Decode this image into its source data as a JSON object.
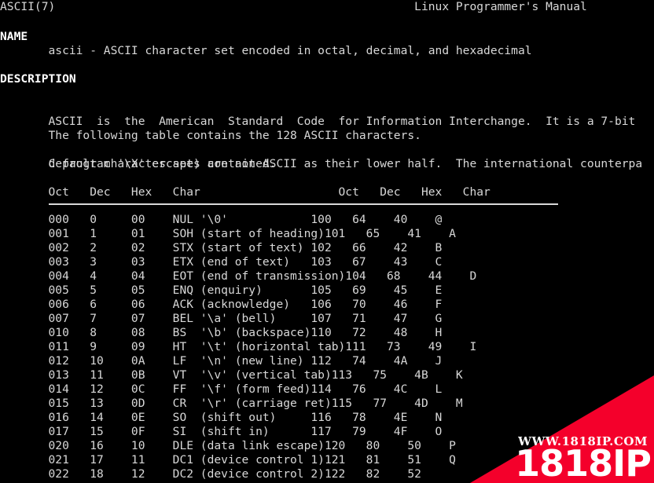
{
  "terminal": {
    "background_color": "#000000",
    "foreground_color": "#d8d8d8",
    "bold_color": "#ffffff"
  },
  "manpage": {
    "header_left": "ASCII(7)",
    "header_center": "Linux Programmer's Manual",
    "header_line": "ASCII(7)                                                    Linux Programmer's Manual",
    "sections": {
      "name_heading": "NAME",
      "name_body": "       ascii - ASCII character set encoded in octal, decimal, and hexadecimal",
      "description_heading": "DESCRIPTION",
      "description_line1": "       ASCII  is  the  American  Standard  Code  for Information Interchange.  It is a 7-bit",
      "description_line2": "       default character set) contain ASCII as their lower half.  The international counterpa",
      "table_intro": "       The following table contains the 128 ASCII characters.",
      "escape_note": "       C program '\\X' escapes are noted."
    }
  },
  "table": {
    "header_line": "       Oct   Dec   Hex   Char                    Oct   Dec   Hex   Char",
    "columns": [
      "Oct",
      "Dec",
      "Hex",
      "Char"
    ],
    "rule_visible": true,
    "rows": [
      {
        "left": {
          "oct": "000",
          "dec": "0",
          "hex": "00",
          "char": "NUL '\\0'"
        },
        "right": {
          "oct": "100",
          "dec": "64",
          "hex": "40",
          "char": "@"
        }
      },
      {
        "left": {
          "oct": "001",
          "dec": "1",
          "hex": "01",
          "char": "SOH (start of heading)"
        },
        "right": {
          "oct": "101",
          "dec": "65",
          "hex": "41",
          "char": "A"
        }
      },
      {
        "left": {
          "oct": "002",
          "dec": "2",
          "hex": "02",
          "char": "STX (start of text)"
        },
        "right": {
          "oct": "102",
          "dec": "66",
          "hex": "42",
          "char": "B"
        }
      },
      {
        "left": {
          "oct": "003",
          "dec": "3",
          "hex": "03",
          "char": "ETX (end of text)"
        },
        "right": {
          "oct": "103",
          "dec": "67",
          "hex": "43",
          "char": "C"
        }
      },
      {
        "left": {
          "oct": "004",
          "dec": "4",
          "hex": "04",
          "char": "EOT (end of transmission)"
        },
        "right": {
          "oct": "104",
          "dec": "68",
          "hex": "44",
          "char": "D"
        }
      },
      {
        "left": {
          "oct": "005",
          "dec": "5",
          "hex": "05",
          "char": "ENQ (enquiry)"
        },
        "right": {
          "oct": "105",
          "dec": "69",
          "hex": "45",
          "char": "E"
        }
      },
      {
        "left": {
          "oct": "006",
          "dec": "6",
          "hex": "06",
          "char": "ACK (acknowledge)"
        },
        "right": {
          "oct": "106",
          "dec": "70",
          "hex": "46",
          "char": "F"
        }
      },
      {
        "left": {
          "oct": "007",
          "dec": "7",
          "hex": "07",
          "char": "BEL '\\a' (bell)"
        },
        "right": {
          "oct": "107",
          "dec": "71",
          "hex": "47",
          "char": "G"
        }
      },
      {
        "left": {
          "oct": "010",
          "dec": "8",
          "hex": "08",
          "char": "BS  '\\b' (backspace)"
        },
        "right": {
          "oct": "110",
          "dec": "72",
          "hex": "48",
          "char": "H"
        }
      },
      {
        "left": {
          "oct": "011",
          "dec": "9",
          "hex": "09",
          "char": "HT  '\\t' (horizontal tab)"
        },
        "right": {
          "oct": "111",
          "dec": "73",
          "hex": "49",
          "char": "I"
        }
      },
      {
        "left": {
          "oct": "012",
          "dec": "10",
          "hex": "0A",
          "char": "LF  '\\n' (new line)"
        },
        "right": {
          "oct": "112",
          "dec": "74",
          "hex": "4A",
          "char": "J"
        }
      },
      {
        "left": {
          "oct": "013",
          "dec": "11",
          "hex": "0B",
          "char": "VT  '\\v' (vertical tab)"
        },
        "right": {
          "oct": "113",
          "dec": "75",
          "hex": "4B",
          "char": "K"
        }
      },
      {
        "left": {
          "oct": "014",
          "dec": "12",
          "hex": "0C",
          "char": "FF  '\\f' (form feed)"
        },
        "right": {
          "oct": "114",
          "dec": "76",
          "hex": "4C",
          "char": "L"
        }
      },
      {
        "left": {
          "oct": "015",
          "dec": "13",
          "hex": "0D",
          "char": "CR  '\\r' (carriage ret)"
        },
        "right": {
          "oct": "115",
          "dec": "77",
          "hex": "4D",
          "char": "M"
        }
      },
      {
        "left": {
          "oct": "016",
          "dec": "14",
          "hex": "0E",
          "char": "SO  (shift out)"
        },
        "right": {
          "oct": "116",
          "dec": "78",
          "hex": "4E",
          "char": "N"
        }
      },
      {
        "left": {
          "oct": "017",
          "dec": "15",
          "hex": "0F",
          "char": "SI  (shift in)"
        },
        "right": {
          "oct": "117",
          "dec": "79",
          "hex": "4F",
          "char": "O"
        }
      },
      {
        "left": {
          "oct": "020",
          "dec": "16",
          "hex": "10",
          "char": "DLE (data link escape)"
        },
        "right": {
          "oct": "120",
          "dec": "80",
          "hex": "50",
          "char": "P"
        }
      },
      {
        "left": {
          "oct": "021",
          "dec": "17",
          "hex": "11",
          "char": "DC1 (device control 1)"
        },
        "right": {
          "oct": "121",
          "dec": "81",
          "hex": "51",
          "char": "Q"
        }
      },
      {
        "left": {
          "oct": "022",
          "dec": "18",
          "hex": "12",
          "char": "DC2 (device control 2)"
        },
        "right": {
          "oct": "122",
          "dec": "82",
          "hex": "52",
          "char": ""
        }
      }
    ]
  },
  "watermark": {
    "url_text": "WWW.1818IP.COM",
    "brand_text": "1818IP",
    "banner_color": "#f4002b",
    "text_color": "#ffffff"
  }
}
